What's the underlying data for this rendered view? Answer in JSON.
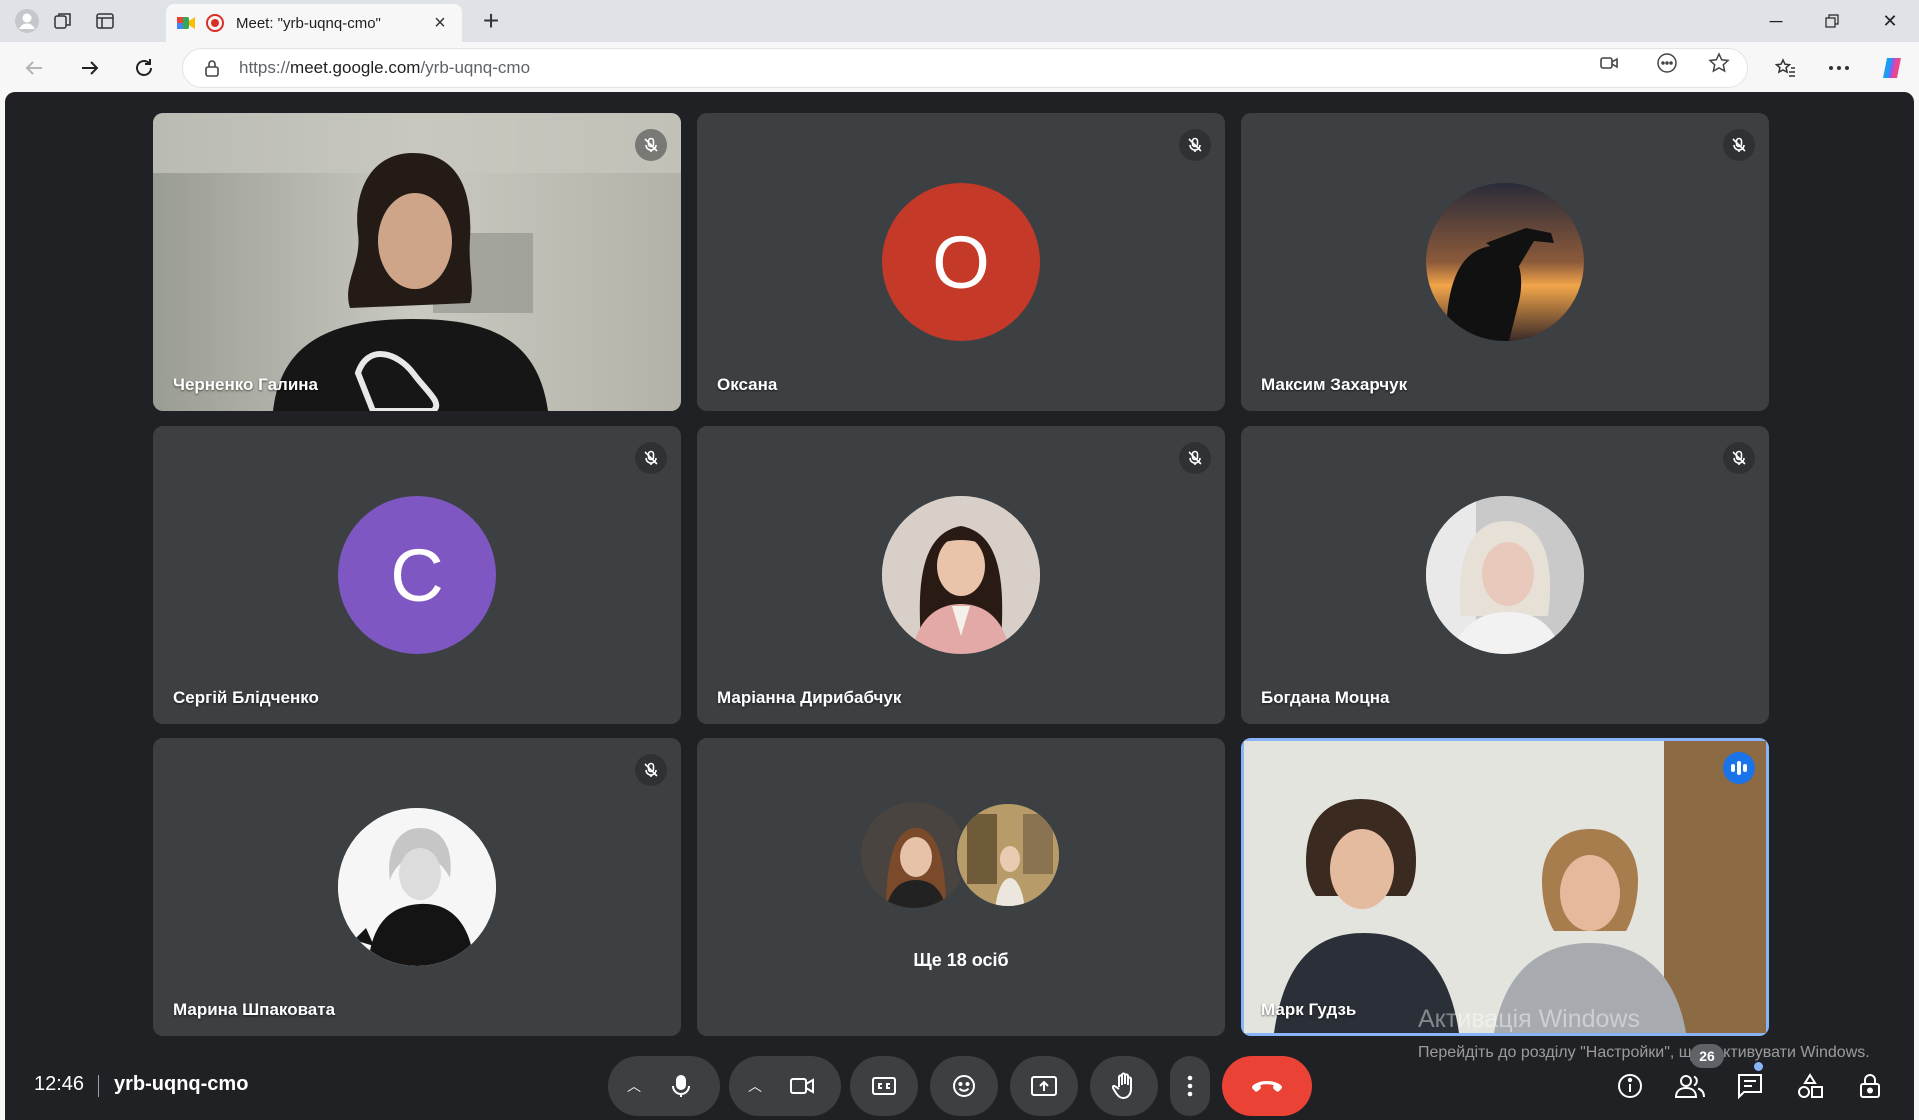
{
  "browser": {
    "tab_title": "Meet: \"yrb-uqnq-cmo\"",
    "url_scheme": "https://",
    "url_host": "meet.google.com",
    "url_path": "/yrb-uqnq-cmo"
  },
  "participants": [
    {
      "name": "Черненко Галина",
      "type": "video",
      "muted": true
    },
    {
      "name": "Оксана",
      "initial": "О",
      "avatar_color": "#c53929",
      "muted": true
    },
    {
      "name": "Максим Захарчук",
      "type": "photo",
      "muted": true
    },
    {
      "name": "Сергій Блідченко",
      "initial": "С",
      "avatar_color": "#7e57c2",
      "muted": true
    },
    {
      "name": "Маріанна Дирибабчук",
      "type": "photo",
      "muted": true
    },
    {
      "name": "Богдана Моцна",
      "type": "photo",
      "muted": true
    },
    {
      "name": "Марина Шпаковата",
      "type": "photo",
      "muted": true
    },
    {
      "name": "Ще 18 осіб",
      "type": "others"
    },
    {
      "name": "Марк Гудзь",
      "type": "video",
      "speaking": true
    }
  ],
  "meeting": {
    "time": "12:46",
    "code": "yrb-uqnq-cmo",
    "participant_count": "26"
  },
  "watermark": {
    "title": "Активація Windows",
    "text": "Перейдіть до розділу \"Настройки\", щоб активувати Windows."
  },
  "colors": {
    "background": "#202124",
    "tile": "#3c4043",
    "end_call": "#ea4335",
    "active_outline": "#8ab4f8",
    "speaking": "#1a73e8"
  }
}
